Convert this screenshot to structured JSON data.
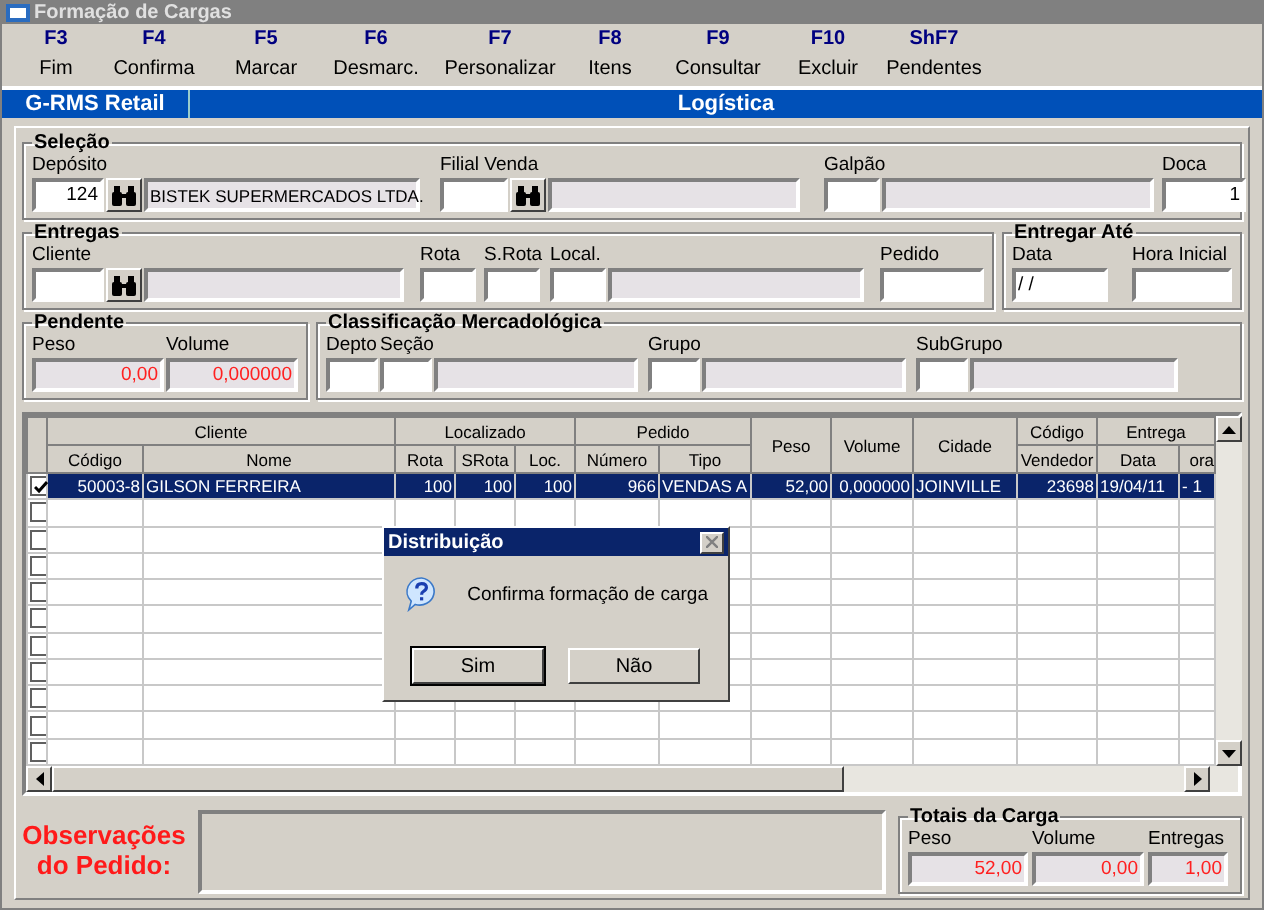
{
  "window": {
    "title": "Formação de Cargas"
  },
  "toolbar": [
    {
      "key": "F3",
      "label": "Fim"
    },
    {
      "key": "F4",
      "label": "Confirma"
    },
    {
      "key": "F5",
      "label": "Marcar"
    },
    {
      "key": "F6",
      "label": "Desmarc."
    },
    {
      "key": "F7",
      "label": "Personalizar"
    },
    {
      "key": "F8",
      "label": "Itens"
    },
    {
      "key": "F9",
      "label": "Consultar"
    },
    {
      "key": "F10",
      "label": "Excluir"
    },
    {
      "key": "ShF7",
      "label": "Pendentes"
    }
  ],
  "banner": {
    "left": "G-RMS Retail",
    "right": "Logística"
  },
  "selecao": {
    "title": "Seleção",
    "deposito": {
      "label": "Depósito",
      "value": "124",
      "name": "BISTEK SUPERMERCADOS LTDA."
    },
    "filial": {
      "label": "Filial Venda"
    },
    "galpao": {
      "label": "Galpão"
    },
    "doca": {
      "label": "Doca",
      "value": "1"
    }
  },
  "entregas": {
    "title": "Entregas",
    "cliente": {
      "label": "Cliente"
    },
    "rota": {
      "label": "Rota"
    },
    "srota": {
      "label": "S.Rota"
    },
    "local": {
      "label": "Local."
    },
    "pedido": {
      "label": "Pedido"
    }
  },
  "entregar_ate": {
    "title": "Entregar Até",
    "data": {
      "label": "Data",
      "value": " / /"
    },
    "hora": {
      "label": "Hora Inicial"
    }
  },
  "pendente": {
    "title": "Pendente",
    "peso": {
      "label": "Peso",
      "value": "0,00"
    },
    "volume": {
      "label": "Volume",
      "value": "0,000000"
    }
  },
  "classificacao": {
    "title": "Classificação Mercadológica",
    "depto": {
      "label": "Depto"
    },
    "secao": {
      "label": "Seção"
    },
    "grupo": {
      "label": "Grupo"
    },
    "subgrupo": {
      "label": "SubGrupo"
    }
  },
  "grid": {
    "group_headers": [
      "Cliente",
      "Localizado",
      "Pedido",
      "Peso",
      "Volume",
      "Cidade",
      "Código",
      "Entrega"
    ],
    "columns": [
      "Código",
      "Nome",
      "Rota",
      "SRota",
      "Loc.",
      "Número",
      "Tipo",
      "Vendedor",
      "Data",
      "ora"
    ],
    "rows": [
      {
        "checked": true,
        "selected": true,
        "cells": [
          "50003-8",
          "GILSON FERREIRA",
          "100",
          "100",
          "100",
          "966",
          "VENDAS A",
          "52,00",
          "0,000000",
          "JOINVILLE",
          "23698",
          "19/04/11",
          "- 1"
        ]
      },
      {
        "checked": false,
        "selected": false
      },
      {
        "checked": false,
        "selected": false
      },
      {
        "checked": false,
        "selected": false
      },
      {
        "checked": false,
        "selected": false
      },
      {
        "checked": false,
        "selected": false
      },
      {
        "checked": false,
        "selected": false
      },
      {
        "checked": false,
        "selected": false
      },
      {
        "checked": false,
        "selected": false
      },
      {
        "checked": false,
        "selected": false
      },
      {
        "checked": false,
        "selected": false
      }
    ]
  },
  "observacoes": {
    "label": "Observações do Pedido:"
  },
  "totais": {
    "title": "Totais da Carga",
    "peso": {
      "label": "Peso",
      "value": "52,00"
    },
    "volume": {
      "label": "Volume",
      "value": "0,00"
    },
    "entregas": {
      "label": "Entregas",
      "value": "1,00"
    }
  },
  "dialog": {
    "title": "Distribuição",
    "message": "Confirma formação de carga",
    "buttons": [
      {
        "label": "Sim",
        "default": true
      },
      {
        "label": "Não",
        "default": false
      }
    ]
  }
}
